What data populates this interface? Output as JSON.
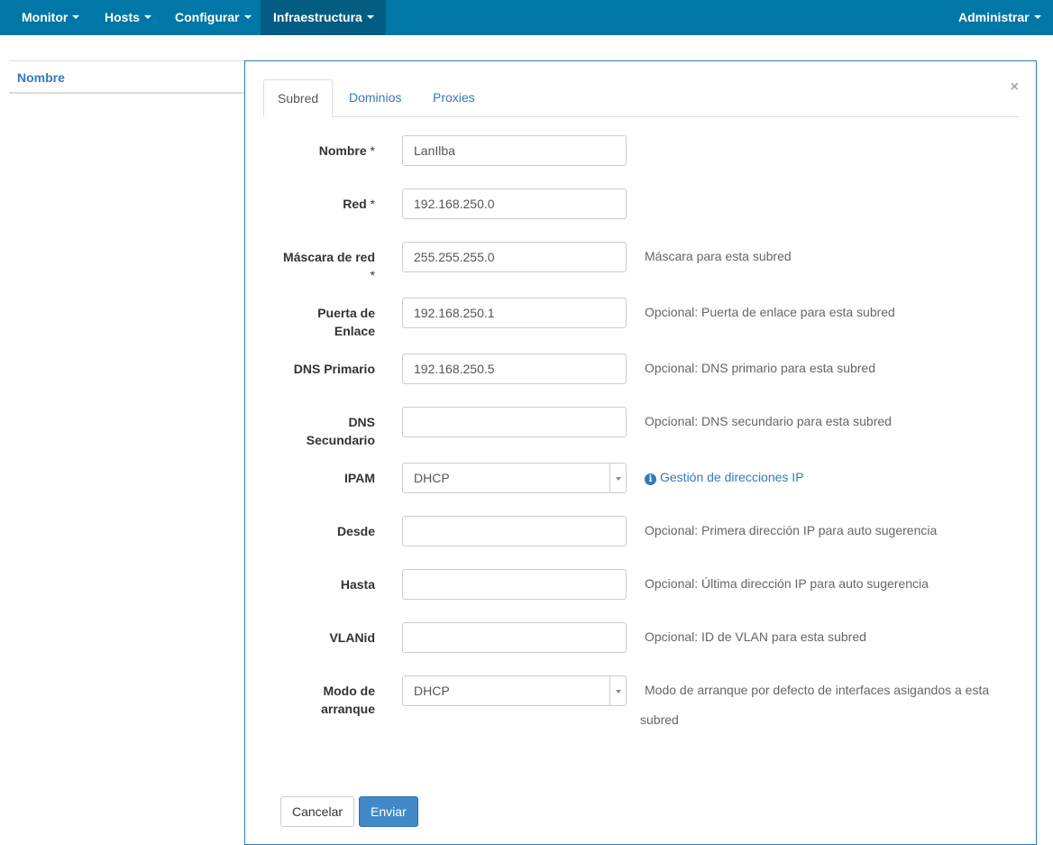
{
  "navbar": {
    "items": [
      {
        "label": "Monitor"
      },
      {
        "label": "Hosts"
      },
      {
        "label": "Configurar"
      },
      {
        "label": "Infraestructura"
      }
    ],
    "right": {
      "label": "Administrar"
    }
  },
  "background_table": {
    "column_header": "Nombre"
  },
  "modal": {
    "close_label": "×",
    "tabs": [
      {
        "label": "Subred"
      },
      {
        "label": "Dominios"
      },
      {
        "label": "Proxies"
      }
    ],
    "fields": {
      "nombre": {
        "label": "Nombre",
        "required": "*",
        "value": "LanIlba"
      },
      "red": {
        "label": "Red",
        "required": "*",
        "value": "192.168.250.0"
      },
      "mascara": {
        "label": "Máscara de red",
        "required": "*",
        "value": "255.255.255.0",
        "help": "Máscara para esta subred"
      },
      "puerta": {
        "label_line1": "Puerta de",
        "label_line2": "Enlace",
        "value": "192.168.250.1",
        "help": "Opcional: Puerta de enlace para esta subred"
      },
      "dns_primario": {
        "label": "DNS Primario",
        "value": "192.168.250.5",
        "help": "Opcional: DNS primario para esta subred"
      },
      "dns_secundario": {
        "label_line1": "DNS",
        "label_line2": "Secundario",
        "value": "",
        "help": "Opcional: DNS secundario para esta subred"
      },
      "ipam": {
        "label": "IPAM",
        "value": "DHCP",
        "help_link": "Gestión de direcciones IP",
        "help_icon": "info-icon"
      },
      "desde": {
        "label": "Desde",
        "value": "",
        "help": "Opcional: Primera dirección IP para auto sugerencia"
      },
      "hasta": {
        "label": "Hasta",
        "value": "",
        "help": "Opcional: Última dirección IP para auto sugerencia"
      },
      "vlanid": {
        "label": "VLANid",
        "value": "",
        "help": "Opcional: ID de VLAN para esta subred"
      },
      "modo_arranque": {
        "label_line1": "Modo de",
        "label_line2": "arranque",
        "value": "DHCP",
        "help_line1": "Modo de arranque por defecto de interfaces asigandos a esta",
        "help_line2": "subred"
      }
    },
    "buttons": {
      "cancel": "Cancelar",
      "submit": "Enviar"
    }
  },
  "colors": {
    "navbar": "#0077a6",
    "navbar_active": "#035d83",
    "link": "#337ab7",
    "primary_button": "#4189c7"
  }
}
